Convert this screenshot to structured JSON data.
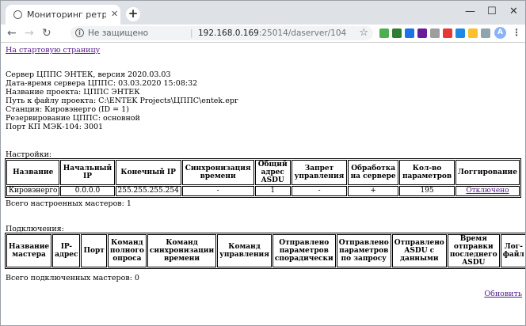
{
  "browser": {
    "tab_title": "Мониторинг ретрансляции данн",
    "tab_close": "✕",
    "newtab": "+",
    "security": "Не защищено",
    "separator": "|",
    "url_host": "192.168.0.169",
    "url_rest": ":25014/daserver/104",
    "window_controls": {
      "min": "—",
      "max": "☐",
      "close": "✕"
    },
    "icons": [
      "back-icon",
      "forward-icon",
      "reload-icon",
      "home-icon",
      "star-icon",
      "avatar-icon",
      "menu-icon"
    ],
    "avatar_letter": "A",
    "extensions": [
      "#4caf50",
      "#2e7d32",
      "#1a73e8",
      "#6a1b9a",
      "#9e9e9e",
      "#e53935",
      "#1e88e5",
      "#fbc02d",
      "#90a4ae"
    ]
  },
  "page": {
    "home_link": "На стартовую страницу",
    "info": [
      "Сервер ЦППС ЭНТЕК, версия 2020.03.03",
      "Дата-время сервера ЦППС: 03.03.2020 15:08:32",
      "Название проекта: ЦППС ЭНТЕК",
      "Путь к файлу проекта: C:\\ENTEK Projects\\ЦППС\\entek.epr",
      "Станция: Кировэнерго (ID = 1)",
      "Резервирование ЦППС: основной",
      "Порт КП МЭК-104: 3001"
    ],
    "settings": {
      "label": "Настройки:",
      "headers": [
        "Название",
        "Начальный IP",
        "Конечный IP",
        "Синхронизация времени",
        "Общий адрес ASDU",
        "Запрет управления",
        "Обработка на сервере",
        "Кол-во параметров",
        "Логгирование"
      ],
      "row": [
        "Кировэнерго",
        "0.0.0.0",
        "255.255.255.254",
        "-",
        "1",
        "-",
        "+",
        "195"
      ],
      "logging_link": "Отключено"
    },
    "total_masters": "Всего настроенных мастеров: 1",
    "connections": {
      "label": "Подключения:",
      "headers": [
        "Название мастера",
        "IP-адрес",
        "Порт",
        "Команд полного опроса",
        "Команд синхронизации времени",
        "Команд управления",
        "Отправлено параметров спорадически",
        "Отправлено параметров по запросу",
        "Отправлено ASDU с данными",
        "Время отправки последнего ASDU",
        "Лог-файл"
      ]
    },
    "total_connected": "Всего подключенных мастеров: 0",
    "refresh_link": "Обновить"
  }
}
